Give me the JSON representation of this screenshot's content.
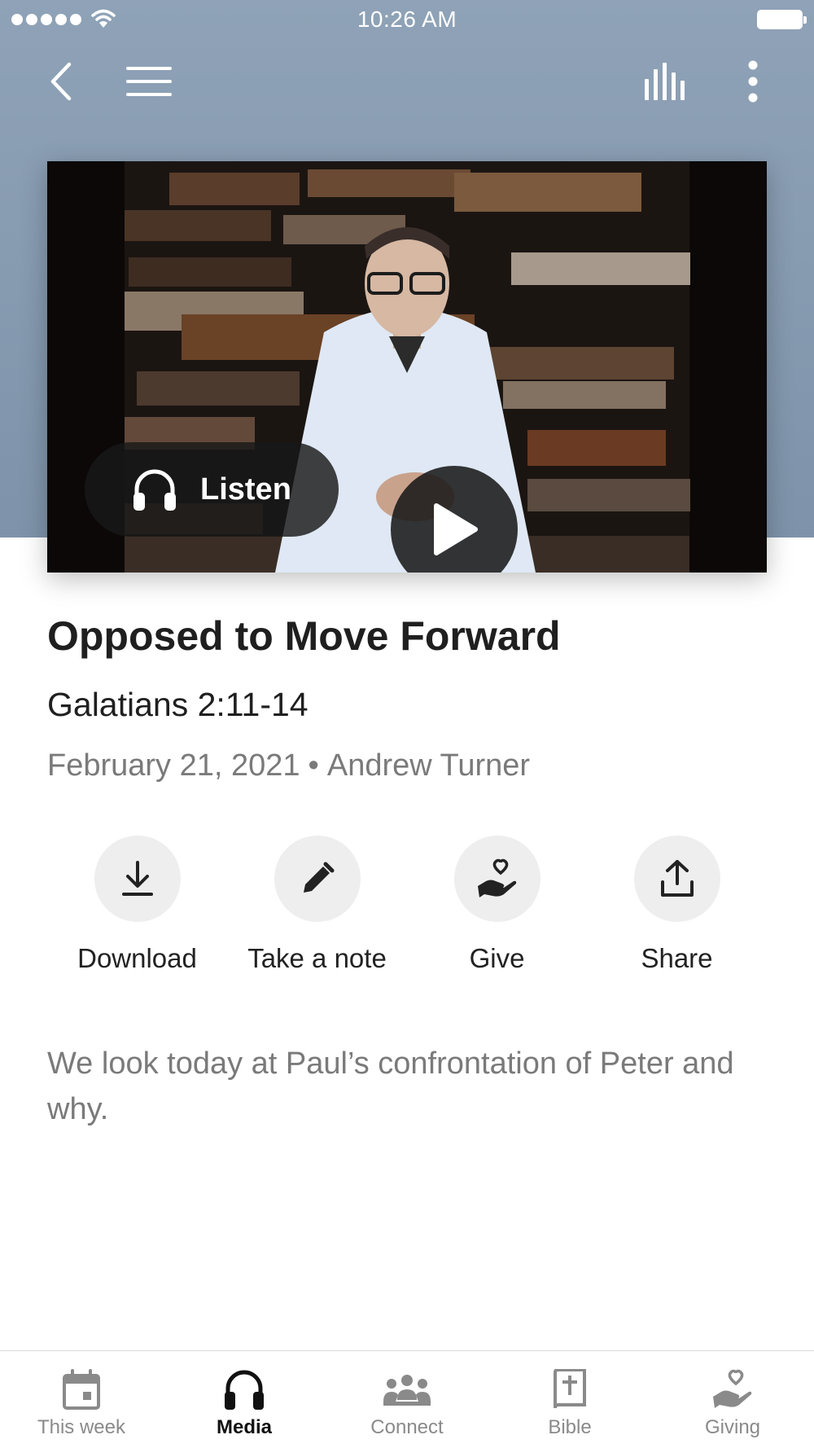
{
  "status_bar": {
    "time": "10:26 AM"
  },
  "nav": {
    "back_icon": "chevron-left-icon",
    "menu_icon": "hamburger-menu-icon",
    "audio_icon": "audio-bars-icon",
    "more_icon": "more-vertical-icon"
  },
  "media": {
    "play_icon": "play-icon",
    "listen_label": "Listen",
    "listen_icon": "headphones-icon"
  },
  "sermon": {
    "title": "Opposed to Move Forward",
    "scripture": "Galatians 2:11-14",
    "date": "February 21, 2021",
    "separator": "•",
    "speaker": "Andrew Turner",
    "description": "We look today at Paul’s confrontation of Peter and why."
  },
  "actions": [
    {
      "label": "Download",
      "icon": "download-icon"
    },
    {
      "label": "Take a note",
      "icon": "pencil-icon"
    },
    {
      "label": "Give",
      "icon": "hand-heart-icon"
    },
    {
      "label": "Share",
      "icon": "share-icon"
    }
  ],
  "tabs": [
    {
      "label": "This week",
      "icon": "calendar-icon",
      "active": false
    },
    {
      "label": "Media",
      "icon": "headphones-icon",
      "active": true
    },
    {
      "label": "Connect",
      "icon": "people-icon",
      "active": false
    },
    {
      "label": "Bible",
      "icon": "bible-icon",
      "active": false
    },
    {
      "label": "Giving",
      "icon": "hand-heart-icon",
      "active": false
    }
  ],
  "colors": {
    "header_background": "#8fa2b7",
    "active_tab": "#111111",
    "inactive_tab": "#8a8a8a",
    "action_circle": "#eeeeee"
  }
}
